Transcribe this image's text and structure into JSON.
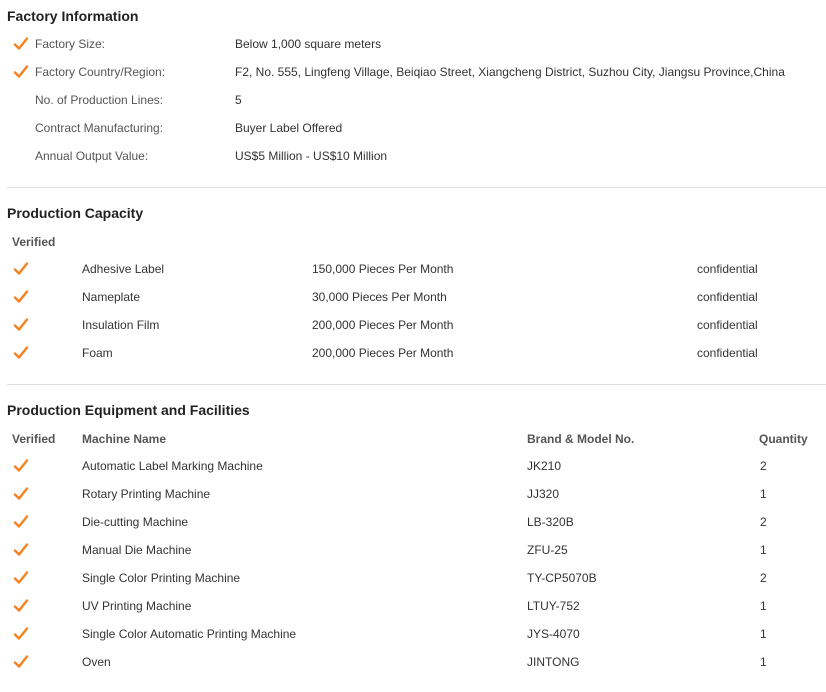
{
  "colors": {
    "accent": "#f5821f"
  },
  "factory_info": {
    "title": "Factory Information",
    "rows": [
      {
        "label": "Factory Size:",
        "value": "Below 1,000 square meters",
        "verified": true
      },
      {
        "label": "Factory Country/Region:",
        "value": "F2, No. 555, Lingfeng Village, Beiqiao Street, Xiangcheng District, Suzhou City, Jiangsu Province,China",
        "verified": true
      },
      {
        "label": "No. of Production Lines:",
        "value": "5",
        "verified": false
      },
      {
        "label": "Contract Manufacturing:",
        "value": "Buyer Label Offered",
        "verified": false
      },
      {
        "label": "Annual Output Value:",
        "value": "US$5 Million - US$10 Million",
        "verified": false
      }
    ]
  },
  "production_capacity": {
    "title": "Production Capacity",
    "verified_header": "Verified",
    "rows": [
      {
        "name": "Adhesive Label",
        "capacity": "150,000 Pieces Per Month",
        "note": "confidential"
      },
      {
        "name": "Nameplate",
        "capacity": "30,000 Pieces Per Month",
        "note": "confidential"
      },
      {
        "name": "Insulation Film",
        "capacity": "200,000 Pieces Per Month",
        "note": "confidential"
      },
      {
        "name": "Foam",
        "capacity": "200,000 Pieces Per Month",
        "note": "confidential"
      }
    ]
  },
  "equipment": {
    "title": "Production Equipment and Facilities",
    "headers": {
      "verified": "Verified",
      "machine": "Machine Name",
      "brand": "Brand & Model No.",
      "quantity": "Quantity"
    },
    "rows": [
      {
        "name": "Automatic Label Marking Machine",
        "model": "JK210",
        "qty": "2"
      },
      {
        "name": "Rotary Printing Machine",
        "model": "JJ320",
        "qty": "1"
      },
      {
        "name": "Die-cutting Machine",
        "model": "LB-320B",
        "qty": "2"
      },
      {
        "name": "Manual Die Machine",
        "model": "ZFU-25",
        "qty": "1"
      },
      {
        "name": "Single Color Printing Machine",
        "model": "TY-CP5070B",
        "qty": "2"
      },
      {
        "name": "UV Printing Machine",
        "model": "LTUY-752",
        "qty": "1"
      },
      {
        "name": "Single Color Automatic Printing Machine",
        "model": "JYS-4070",
        "qty": "1"
      },
      {
        "name": "Oven",
        "model": "JINTONG",
        "qty": "1"
      }
    ]
  }
}
